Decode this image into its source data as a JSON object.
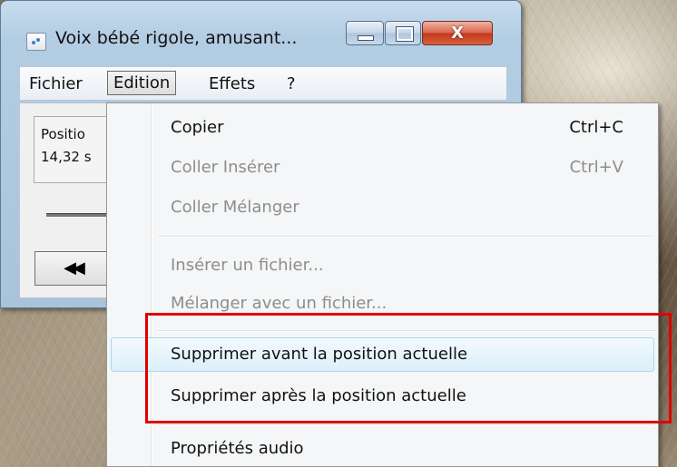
{
  "window": {
    "title": "Voix bébé rigole, amusant...",
    "buttons": {
      "minimize": "",
      "maximize": "",
      "close": "X"
    }
  },
  "menubar": [
    "Fichier",
    "Edition",
    "Effets",
    "?"
  ],
  "panel": {
    "position_label": "Positio",
    "position_value": "14,32 s",
    "rewind_glyph": "◀◀"
  },
  "edit_menu": {
    "items": [
      {
        "label": "Copier",
        "shortcut": "Ctrl+C",
        "enabled": true
      },
      {
        "label": "Coller Insérer",
        "shortcut": "Ctrl+V",
        "enabled": false
      },
      {
        "label": "Coller Mélanger",
        "shortcut": "",
        "enabled": false
      },
      {
        "label": "Insérer un fichier...",
        "shortcut": "",
        "enabled": false
      },
      {
        "label": "Mélanger avec un fichier...",
        "shortcut": "",
        "enabled": false
      },
      {
        "label": "Supprimer avant la position actuelle",
        "shortcut": "",
        "enabled": true,
        "highlighted": true
      },
      {
        "label": "Supprimer après la position actuelle",
        "shortcut": "",
        "enabled": true
      },
      {
        "label": "Propriétés audio",
        "shortcut": "",
        "enabled": true
      }
    ]
  },
  "annotation_color": "#e00000"
}
